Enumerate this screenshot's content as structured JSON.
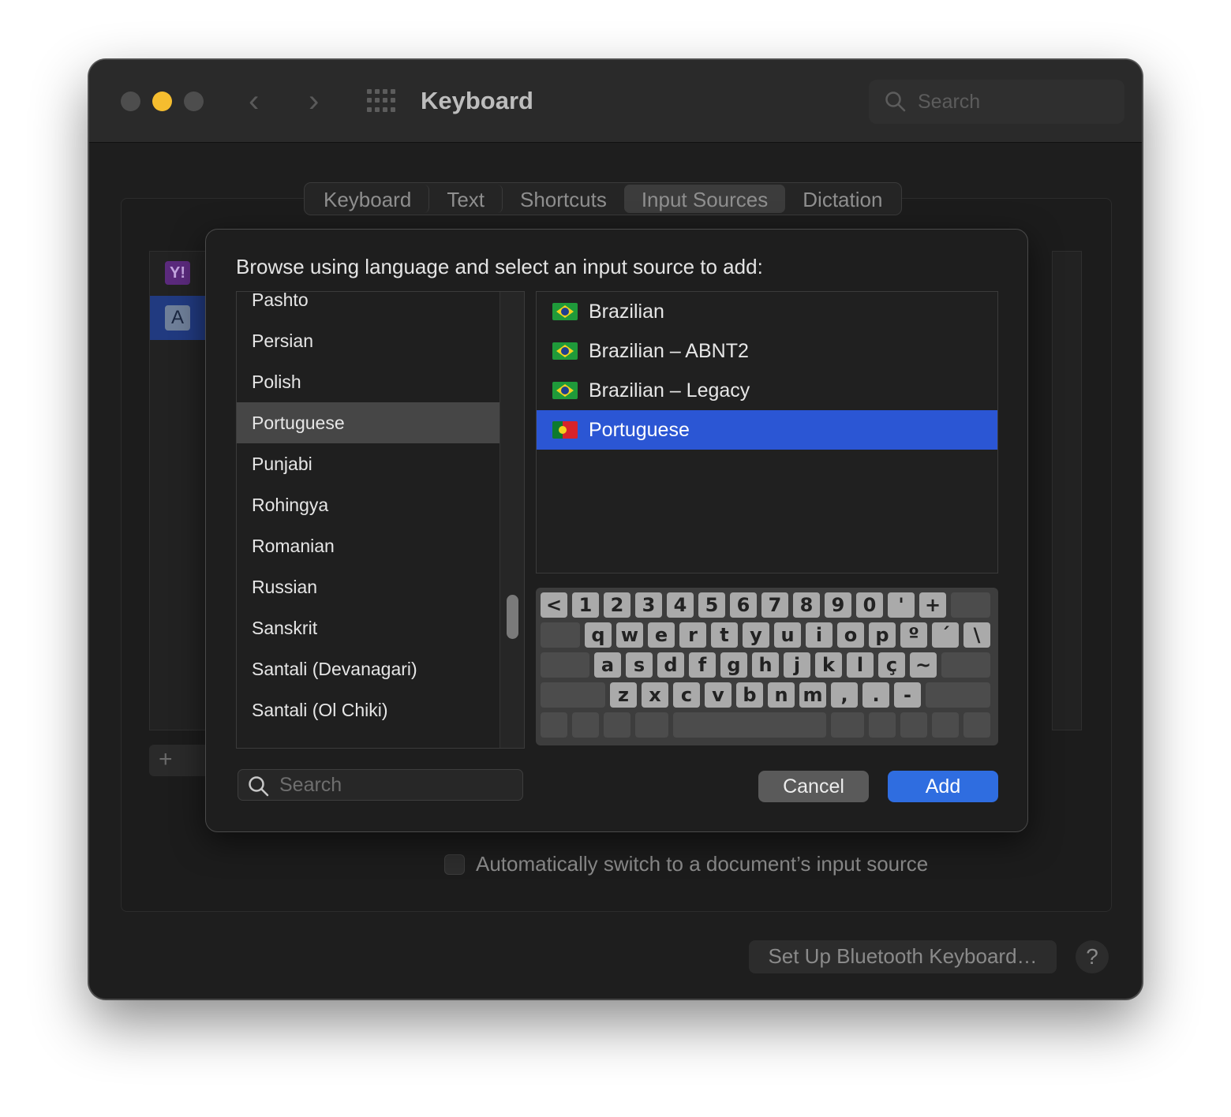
{
  "window": {
    "title": "Keyboard",
    "search_placeholder": "Search"
  },
  "tabs": [
    {
      "label": "Keyboard"
    },
    {
      "label": "Text"
    },
    {
      "label": "Shortcuts"
    },
    {
      "label": "Input Sources",
      "active": true
    },
    {
      "label": "Dictation"
    }
  ],
  "background": {
    "auto_switch_label": "Automatically switch to a document’s input source",
    "bluetooth_button": "Set Up Bluetooth Keyboard…",
    "help_button": "?",
    "add_button": "+",
    "input_source_icons": [
      "Y!",
      "A"
    ]
  },
  "sheet": {
    "title": "Browse using language and select an input source to add:",
    "languages": [
      "Pashto",
      "Persian",
      "Polish",
      "Portuguese",
      "Punjabi",
      "Rohingya",
      "Romanian",
      "Russian",
      "Sanskrit",
      "Santali (Devanagari)",
      "Santali (Ol Chiki)"
    ],
    "selected_language": "Portuguese",
    "sources": [
      {
        "label": "Brazilian",
        "flag": "brazil-flag"
      },
      {
        "label": "Brazilian – ABNT2",
        "flag": "brazil-flag"
      },
      {
        "label": "Brazilian – Legacy",
        "flag": "brazil-flag"
      },
      {
        "label": "Portuguese",
        "flag": "portugal-flag",
        "selected": true
      }
    ],
    "search_placeholder": "Search",
    "cancel_label": "Cancel",
    "add_label": "Add",
    "keyboard": {
      "row1": [
        "<",
        "1",
        "2",
        "3",
        "4",
        "5",
        "6",
        "7",
        "8",
        "9",
        "0",
        "'",
        "+"
      ],
      "row2": [
        "q",
        "w",
        "e",
        "r",
        "t",
        "y",
        "u",
        "i",
        "o",
        "p",
        "º",
        "´",
        "\\"
      ],
      "row3": [
        "a",
        "s",
        "d",
        "f",
        "g",
        "h",
        "j",
        "k",
        "l",
        "ç",
        "~"
      ],
      "row4": [
        "z",
        "x",
        "c",
        "v",
        "b",
        "n",
        "m",
        ",",
        ".",
        "-"
      ]
    }
  },
  "colors": {
    "accent": "#2f6de0",
    "selection": "#2b56d4",
    "window_bg": "#1e1e1e",
    "minimize": "#f5bd2f"
  }
}
